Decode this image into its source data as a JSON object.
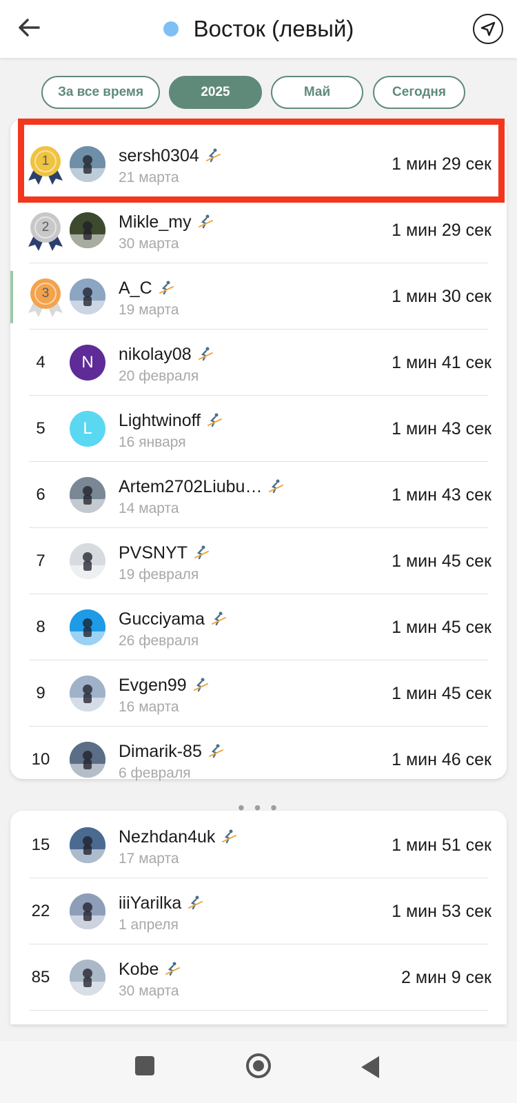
{
  "header": {
    "title": "Восток (левый)",
    "dot_color": "#7ec0f5",
    "back_icon": "arrow-left-icon",
    "nav_icon": "navigation-arrow-icon"
  },
  "filters": [
    {
      "label": "За все время",
      "active": false
    },
    {
      "label": "2025",
      "active": true
    },
    {
      "label": "Май",
      "active": false
    },
    {
      "label": "Сегодня",
      "active": false
    }
  ],
  "leaderboard_top": [
    {
      "rank": "1",
      "medal": "gold",
      "name": "sersh0304",
      "date": "21 марта",
      "time": "1 мин 29 сек",
      "avatar": {
        "type": "photo",
        "bg": "#6f8fa8"
      }
    },
    {
      "rank": "2",
      "medal": "silver",
      "name": "Mikle_my",
      "date": "30 марта",
      "time": "1 мин 29 сек",
      "avatar": {
        "type": "photo",
        "bg": "#3d4a2e"
      }
    },
    {
      "rank": "3",
      "medal": "bronze",
      "name": "A_C",
      "date": "19 марта",
      "time": "1 мин 30 сек",
      "avatar": {
        "type": "photo",
        "bg": "#8ba5c2"
      }
    },
    {
      "rank": "4",
      "medal": "",
      "name": "nikolay08",
      "date": "20 февраля",
      "time": "1 мин 41 сек",
      "avatar": {
        "type": "letter",
        "letter": "N",
        "bg": "#5e2b97"
      }
    },
    {
      "rank": "5",
      "medal": "",
      "name": "Lightwinoff",
      "date": "16 января",
      "time": "1 мин 43 сек",
      "avatar": {
        "type": "letter",
        "letter": "L",
        "bg": "#5ad8f2"
      }
    },
    {
      "rank": "6",
      "medal": "",
      "name": "Artem2702Liubu…",
      "date": "14 марта",
      "time": "1 мин 43 сек",
      "avatar": {
        "type": "photo",
        "bg": "#7a8794"
      }
    },
    {
      "rank": "7",
      "medal": "",
      "name": "PVSNYT",
      "date": "19 февраля",
      "time": "1 мин 45 сек",
      "avatar": {
        "type": "photo",
        "bg": "#d7dbe0"
      }
    },
    {
      "rank": "8",
      "medal": "",
      "name": "Gucciyama",
      "date": "26 февраля",
      "time": "1 мин 45 сек",
      "avatar": {
        "type": "photo",
        "bg": "#1e9be6"
      }
    },
    {
      "rank": "9",
      "medal": "",
      "name": "Evgen99",
      "date": "16 марта",
      "time": "1 мин 45 сек",
      "avatar": {
        "type": "photo",
        "bg": "#9fb2c9"
      }
    },
    {
      "rank": "10",
      "medal": "",
      "name": "Dimarik-85",
      "date": "6 февраля",
      "time": "1 мин 46 сек",
      "avatar": {
        "type": "photo",
        "bg": "#5c6e86"
      }
    }
  ],
  "ellipsis": "• • •",
  "leaderboard_more": [
    {
      "rank": "15",
      "medal": "",
      "name": "Nezhdan4uk",
      "date": "17 марта",
      "time": "1 мин 51 сек",
      "avatar": {
        "type": "photo",
        "bg": "#4a6a8f"
      }
    },
    {
      "rank": "22",
      "medal": "",
      "name": "iiiYarilka",
      "date": "1 апреля",
      "time": "1 мин 53 сек",
      "avatar": {
        "type": "photo",
        "bg": "#8f9eb8"
      }
    },
    {
      "rank": "85",
      "medal": "",
      "name": "Kobe",
      "date": "30 марта",
      "time": "2 мин 9 сек",
      "avatar": {
        "type": "photo",
        "bg": "#aab8c8"
      }
    }
  ],
  "medal_colors": {
    "gold": "#f0c340",
    "silver": "#c8c8c8",
    "bronze": "#f4a24c",
    "ribbon": "#2a3f6b"
  },
  "selected_row_color": "#f2371e"
}
